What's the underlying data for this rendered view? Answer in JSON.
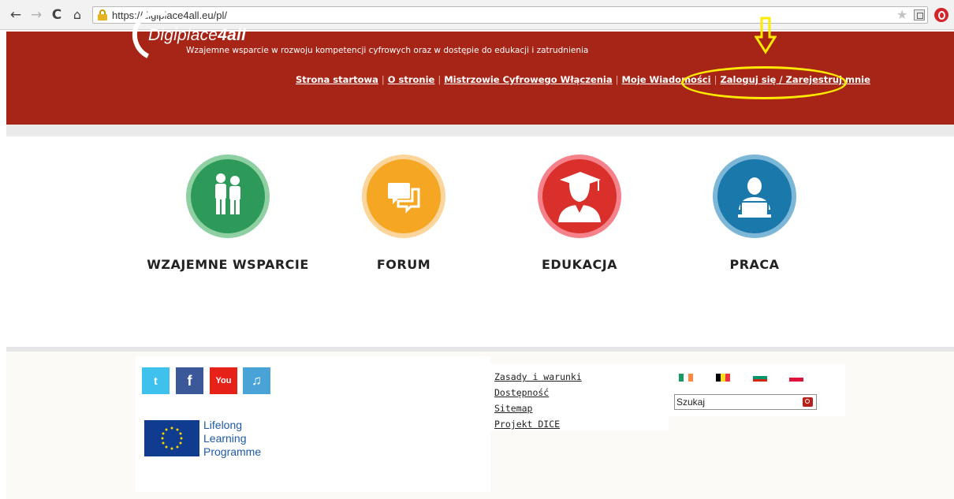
{
  "browser": {
    "url": "https://digiplace4all.eu/pl/",
    "icons": [
      "back-icon",
      "forward-icon",
      "reload-icon",
      "home-icon",
      "lock-icon",
      "star-icon",
      "extension-icon",
      "opera-icon"
    ]
  },
  "header": {
    "logo_light": "Digiplace",
    "logo_bold": "4all",
    "tagline": "Wzajemne wsparcie w rozwoju kompetencji cyfrowych oraz w dostępie do edukacji i zatrudnienia",
    "background": "#a72517",
    "nav": [
      {
        "label": "Strona startowa"
      },
      {
        "label": "O stronie"
      },
      {
        "label": "Mistrzowie Cyfrowego Włączenia"
      },
      {
        "label": "Moje Wiadomości"
      },
      {
        "label": "Zaloguj się / Zarejestruj mnie"
      }
    ],
    "highlight_color": "#ffea00"
  },
  "categories": [
    {
      "label": "WZAJEMNE WSPARCIE",
      "icon": "people-icon",
      "color": "#2e9a5a"
    },
    {
      "label": "FORUM",
      "icon": "chat-bubbles-icon",
      "color": "#f5a623"
    },
    {
      "label": "EDUKACJA",
      "icon": "graduate-icon",
      "color": "#d9302c"
    },
    {
      "label": "PRACA",
      "icon": "laptop-worker-icon",
      "color": "#1b78aa"
    }
  ],
  "footer": {
    "social": [
      "twitter-icon",
      "facebook-icon",
      "youtube-icon",
      "music-icon"
    ],
    "social_glyphs": {
      "twitter": "t",
      "facebook": "f",
      "youtube": "You",
      "music": "♫"
    },
    "llp": [
      "Lifelong",
      "Learning",
      "Programme"
    ],
    "links": [
      "Zasady i warunki",
      "Dostępność",
      "Sitemap",
      "Projekt DICE"
    ],
    "languages": [
      "ie-flag-icon",
      "be-flag-icon",
      "bg-flag-icon",
      "pl-flag-icon"
    ],
    "search_placeholder": "Szukaj"
  }
}
